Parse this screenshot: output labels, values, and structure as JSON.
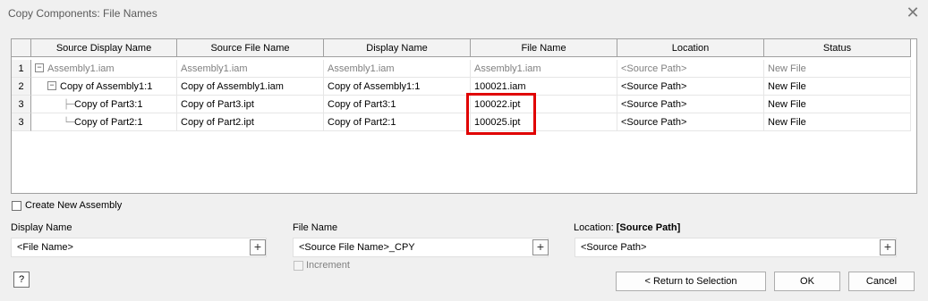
{
  "window": {
    "title": "Copy Components: File Names"
  },
  "grid": {
    "columns": [
      "Source Display Name",
      "Source File Name",
      "Display Name",
      "File Name",
      "Location",
      "Status"
    ],
    "rows": [
      {
        "num": "1",
        "expander": "−",
        "source_display_name": "Assembly1.iam",
        "source_file_name": "Assembly1.iam",
        "display_name": "Assembly1.iam",
        "file_name": "Assembly1.iam",
        "location": "<Source Path>",
        "status": "New File"
      },
      {
        "num": "2",
        "expander": "−",
        "source_display_name": "Copy of Assembly1:1",
        "source_file_name": "Copy of Assembly1.iam",
        "display_name": "Copy of Assembly1:1",
        "file_name": "100021.iam",
        "location": "<Source Path>",
        "status": "New File"
      },
      {
        "num": "3",
        "source_display_name": "Copy of Part3:1",
        "source_file_name": "Copy of Part3.ipt",
        "display_name": "Copy of Part3:1",
        "file_name": "100022.ipt",
        "location": "<Source Path>",
        "status": "New File"
      },
      {
        "num": "3",
        "source_display_name": "Copy of Part2:1",
        "source_file_name": "Copy of Part2.ipt",
        "display_name": "Copy of Part2:1",
        "file_name": "100025.ipt",
        "location": "<Source Path>",
        "status": "New File"
      }
    ]
  },
  "create_new_assembly": {
    "label": "Create New Assembly",
    "checked": false
  },
  "display_name": {
    "label": "Display Name",
    "value": "<File Name>"
  },
  "file_name": {
    "label": "File Name",
    "value": "<Source File Name>_CPY",
    "increment_label": "Increment"
  },
  "location": {
    "label": "Location:",
    "label_value": "[Source Path]",
    "value": "<Source Path>"
  },
  "buttons": {
    "plus": "+",
    "help": "?",
    "return": "< Return to Selection",
    "ok": "OK",
    "cancel": "Cancel"
  },
  "icons": {
    "close": "close-icon",
    "help": "help-icon",
    "plus": "plus-icon"
  },
  "colors": {
    "highlight": "#e00000",
    "disabled_text": "#808080"
  }
}
